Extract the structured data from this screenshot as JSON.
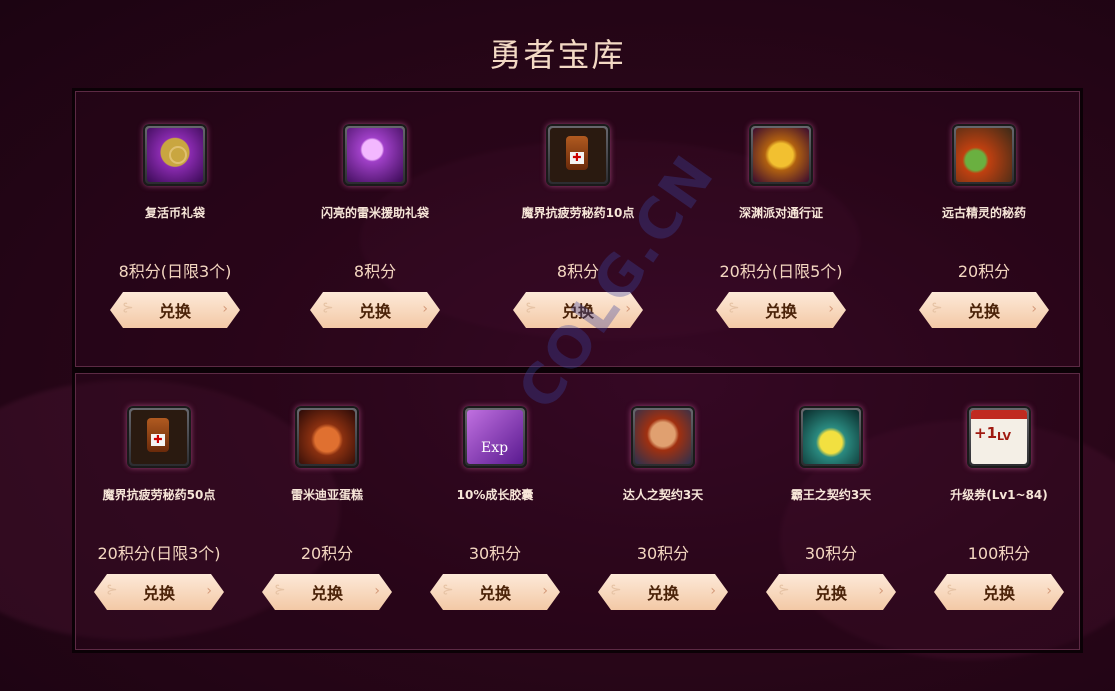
{
  "page": {
    "title": "勇者宝库"
  },
  "watermark": {
    "text": "COLG.CN"
  },
  "row1": [
    {
      "name": "复活币礼袋",
      "price": "8积分(日限3个)",
      "button": "兑换",
      "icon": "revive-coin-bag-icon",
      "color": "#6b1f86"
    },
    {
      "name": "闪亮的雷米援助礼袋",
      "price": "8积分",
      "button": "兑换",
      "icon": "shiny-remy-gift-bag-icon",
      "color": "#8a2aa0"
    },
    {
      "name": "魔界抗疲劳秘药10点",
      "price": "8积分",
      "button": "兑换",
      "icon": "fatigue-potion-icon",
      "color": "#2a1a10"
    },
    {
      "name": "深渊派对通行证",
      "price": "20积分(日限5个)",
      "button": "兑换",
      "icon": "abyss-pass-icon",
      "color": "#4a0f40"
    },
    {
      "name": "远古精灵的秘药",
      "price": "20积分",
      "button": "兑换",
      "icon": "ancient-elf-potion-icon",
      "color": "#3a2a18"
    }
  ],
  "row2": [
    {
      "name": "魔界抗疲劳秘药50点",
      "price": "20积分(日限3个)",
      "button": "兑换",
      "icon": "fatigue-potion-icon",
      "color": "#2a1a10"
    },
    {
      "name": "雷米迪亚蛋糕",
      "price": "20积分",
      "button": "兑换",
      "icon": "cake-icon",
      "color": "#3a1810"
    },
    {
      "name": "10%成长胶囊",
      "price": "30积分",
      "button": "兑换",
      "icon": "exp-capsule-icon",
      "color": "#7a2aa8"
    },
    {
      "name": "达人之契约3天",
      "price": "30积分",
      "button": "兑换",
      "icon": "expert-contract-icon",
      "color": "#3a4a6a"
    },
    {
      "name": "霸王之契约3天",
      "price": "30积分",
      "button": "兑换",
      "icon": "overlord-contract-icon",
      "color": "#1a4a4a"
    },
    {
      "name": "升级券(Lv1~84)",
      "price": "100积分",
      "button": "兑换",
      "icon": "level-up-ticket-icon",
      "color": "#f4efe6"
    }
  ]
}
